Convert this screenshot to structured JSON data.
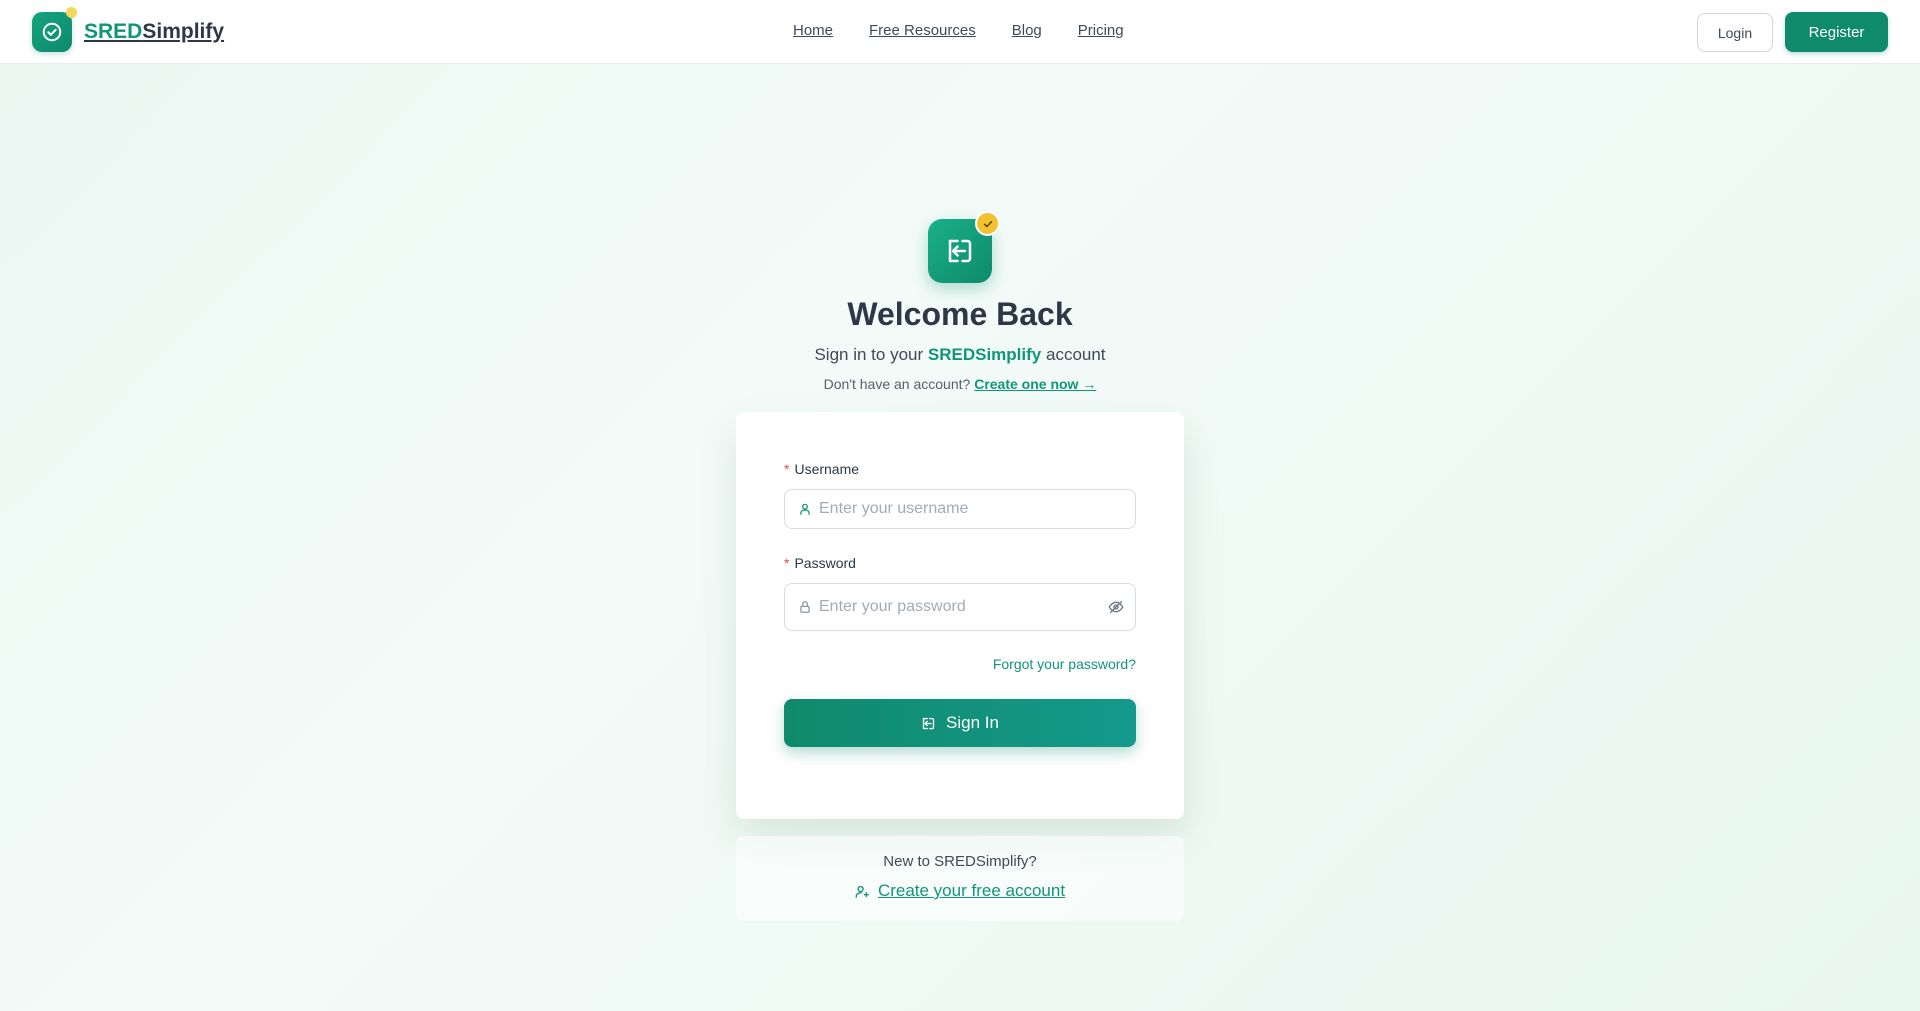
{
  "brand": {
    "name_part1": "SRED",
    "name_part2": "Simplify",
    "accent_color": "#0f8a6c",
    "badge_color": "#f2c230"
  },
  "nav": {
    "items": [
      "Home",
      "Free Resources",
      "Blog",
      "Pricing"
    ]
  },
  "header_actions": {
    "login_label": "Login",
    "register_label": "Register"
  },
  "hero": {
    "icon": "sign-in-icon",
    "badge_icon": "check-icon",
    "title": "Welcome Back",
    "subtitle_prefix": "Sign in to your",
    "subtitle_brand": "SREDSimplify",
    "subtitle_suffix": "account",
    "no_account_text": "Don't have an account?",
    "create_link": "Create one now →"
  },
  "form": {
    "username_label": "Username",
    "username_placeholder": "Enter your username",
    "username_value": "",
    "password_label": "Password",
    "password_placeholder": "Enter your password",
    "password_value": "",
    "required_marker": "*",
    "forgot_link": "Forgot your password?",
    "submit_label": "Sign In"
  },
  "footer_panel": {
    "question": "New to SREDSimplify?",
    "create_label": "Create your free account"
  }
}
